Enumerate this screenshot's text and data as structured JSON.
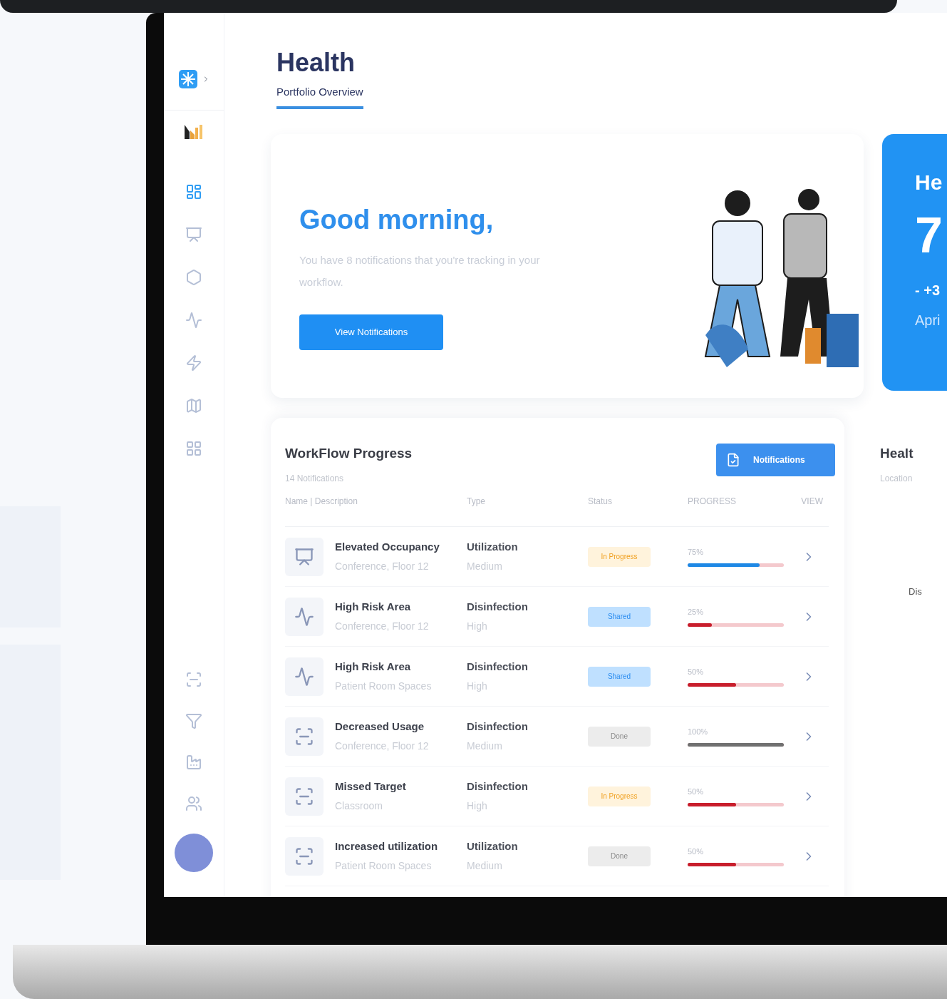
{
  "sidebar": {
    "nav_items": [
      {
        "selected": true
      },
      {
        "selected": false
      },
      {
        "selected": false
      },
      {
        "selected": false
      },
      {
        "selected": false
      },
      {
        "selected": false
      },
      {
        "selected": false
      }
    ]
  },
  "header": {
    "title": "Health",
    "tab": "Portfolio Overview"
  },
  "hero": {
    "greeting": "Good morning,",
    "message": "You have 8 notifications that you're tracking in your workflow.",
    "button": "View Notifications"
  },
  "score_card": {
    "title": "He",
    "value": "7",
    "change": "- +3",
    "date": "Apri"
  },
  "workflow": {
    "title": "WorkFlow Progress",
    "subtitle": "14 Notifications",
    "button": "Notifications",
    "columns": [
      "Name | Description",
      "Type",
      "Status",
      "PROGRESS",
      "VIEW"
    ],
    "rows": [
      {
        "kind": "monitor",
        "name": "Elevated Occupancy",
        "description": "Conference,  Floor 12",
        "type": "Utilization",
        "level_text": "Medium",
        "status": {
          "text": "In Progress",
          "kind": "progress"
        },
        "progress": "75%",
        "level": 0.75,
        "color": "#1e88e5"
      },
      {
        "kind": "pulse",
        "name": "High Risk Area",
        "description": "Conference,  Floor 12",
        "type": "Disinfection",
        "level_text": "High",
        "status": {
          "text": "Shared",
          "kind": "shared"
        },
        "progress": "25%",
        "level": 0.25,
        "color": "#c81e2c"
      },
      {
        "kind": "pulse",
        "name": "High Risk Area",
        "description": "Patient Room Spaces",
        "type": "Disinfection",
        "level_text": "High",
        "status": {
          "text": "Shared",
          "kind": "shared"
        },
        "progress": "50%",
        "level": 0.5,
        "color": "#c81e2c"
      },
      {
        "kind": "sensor",
        "name": "Decreased Usage",
        "description": "Conference,  Floor 12",
        "type": "Disinfection",
        "level_text": "Medium",
        "status": {
          "text": "Done",
          "kind": "done"
        },
        "progress": "100%",
        "level": 1,
        "color": "#707070"
      },
      {
        "kind": "sensor",
        "name": "Missed Target",
        "description": "Classroom",
        "type": "Disinfection",
        "level_text": "High",
        "status": {
          "text": "In Progress",
          "kind": "progress"
        },
        "progress": "50%",
        "level": 0.5,
        "color": "#c81e2c"
      },
      {
        "kind": "sensor",
        "name": "Increased utilization",
        "description": "Patient Room Spaces",
        "type": "Utilization",
        "level_text": "Medium",
        "status": {
          "text": "Done",
          "kind": "done"
        },
        "progress": "50%",
        "level": 0.5,
        "color": "#c81e2c"
      }
    ]
  },
  "side_panel": {
    "title": "Healt",
    "subtitle": "Location",
    "label": "Dis"
  }
}
